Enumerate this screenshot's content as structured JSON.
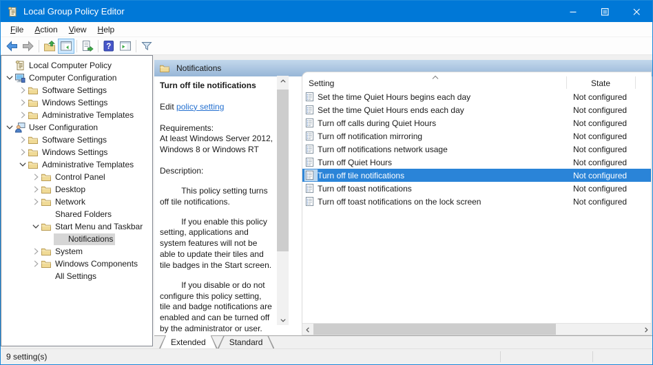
{
  "window": {
    "title": "Local Group Policy Editor"
  },
  "menubar": {
    "items": [
      {
        "key": "F",
        "rest": "ile"
      },
      {
        "key": "A",
        "rest": "ction"
      },
      {
        "key": "V",
        "rest": "iew"
      },
      {
        "key": "H",
        "rest": "elp"
      }
    ]
  },
  "tree": {
    "items": [
      {
        "label": "Local Computer Policy"
      },
      {
        "label": "Computer Configuration"
      },
      {
        "label": "Software Settings"
      },
      {
        "label": "Windows Settings"
      },
      {
        "label": "Administrative Templates"
      },
      {
        "label": "User Configuration"
      },
      {
        "label": "Software Settings"
      },
      {
        "label": "Windows Settings"
      },
      {
        "label": "Administrative Templates"
      },
      {
        "label": "Control Panel"
      },
      {
        "label": "Desktop"
      },
      {
        "label": "Network"
      },
      {
        "label": "Shared Folders"
      },
      {
        "label": "Start Menu and Taskbar"
      },
      {
        "label": "Notifications"
      },
      {
        "label": "System"
      },
      {
        "label": "Windows Components"
      },
      {
        "label": "All Settings"
      }
    ]
  },
  "header": {
    "title": "Notifications"
  },
  "detail": {
    "policy_title": "Turn off tile notifications",
    "edit_prefix": "Edit ",
    "edit_link": "policy setting",
    "requirements_label": "Requirements:",
    "requirements_text": "At least Windows Server 2012, Windows 8 or Windows RT",
    "description_label": "Description:",
    "paragraphs": [
      "This policy setting turns off tile notifications.",
      "If you enable this policy setting, applications and system features will not be able to update their tiles and tile badges in the Start screen.",
      "If you disable or do not configure this policy setting, tile and badge notifications are enabled and can be turned off by the administrator or user."
    ]
  },
  "list": {
    "columns": {
      "setting": "Setting",
      "state": "State"
    },
    "selected_index": 6,
    "rows": [
      {
        "setting": "Set the time Quiet Hours begins each day",
        "state": "Not configured"
      },
      {
        "setting": "Set the time Quiet Hours ends each day",
        "state": "Not configured"
      },
      {
        "setting": "Turn off calls during Quiet Hours",
        "state": "Not configured"
      },
      {
        "setting": "Turn off notification mirroring",
        "state": "Not configured"
      },
      {
        "setting": "Turn off notifications network usage",
        "state": "Not configured"
      },
      {
        "setting": "Turn off Quiet Hours",
        "state": "Not configured"
      },
      {
        "setting": "Turn off tile notifications",
        "state": "Not configured"
      },
      {
        "setting": "Turn off toast notifications",
        "state": "Not configured"
      },
      {
        "setting": "Turn off toast notifications on the lock screen",
        "state": "Not configured"
      }
    ]
  },
  "tabs": {
    "extended": "Extended",
    "standard": "Standard"
  },
  "statusbar": {
    "text": "9 setting(s)"
  },
  "colors": {
    "titlebar": "#0078d7",
    "selection_blue": "#2a84d8",
    "tree_selection_gray": "#d6d6d6",
    "header_band_top": "#c3d8ec",
    "header_band_bottom": "#97b6d7",
    "link": "#2470d0",
    "window_border": "#1986d8"
  }
}
